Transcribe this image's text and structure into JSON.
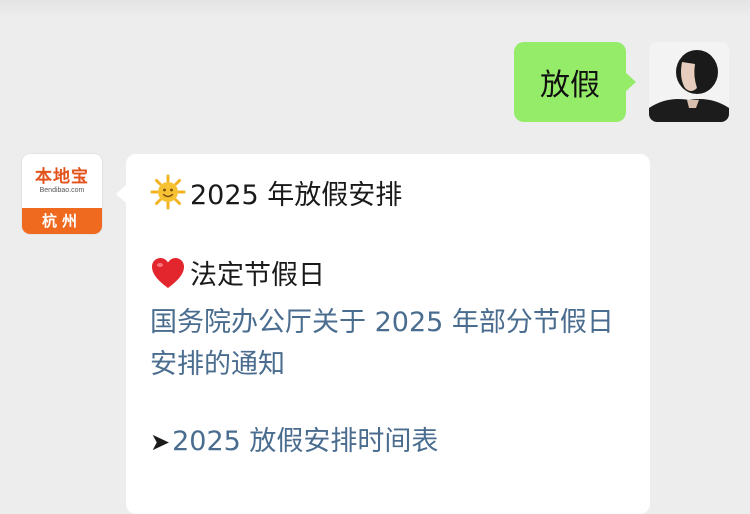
{
  "chat": {
    "sent_message": {
      "text": "放假"
    },
    "account_avatar": {
      "brand_text": "本地宝",
      "domain_text": "Bendibao.com",
      "city_text": "杭州",
      "brand_color": "#ef6a1f"
    },
    "received_message": {
      "heading": "2025 年放假安排",
      "section_title": "法定节假日",
      "notice_link": "国务院办公厅关于 2025 年部分节假日安排的通知",
      "schedule_link": "2025 放假安排时间表",
      "arrow_glyph": "➤",
      "heading_icon": "sun-emoji-icon",
      "section_icon": "red-heart-icon",
      "link_color": "#4a6d8f"
    }
  }
}
